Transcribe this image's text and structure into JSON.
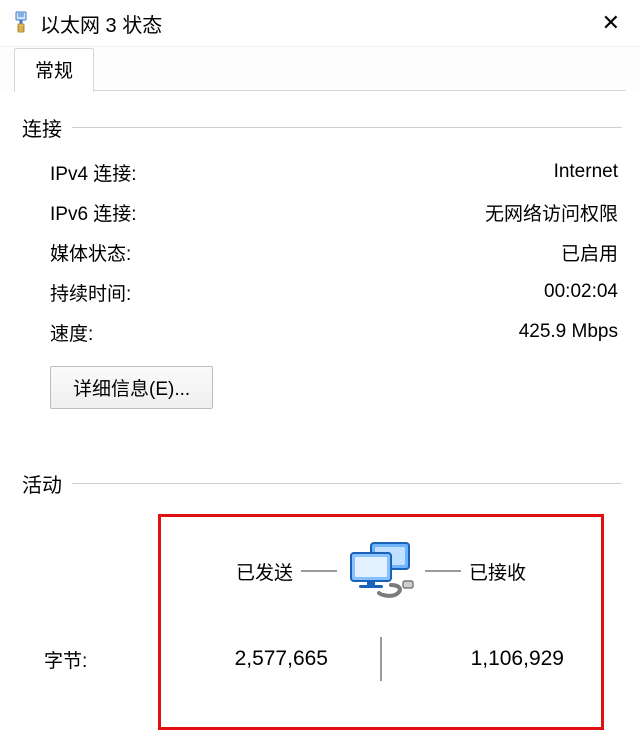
{
  "title": "以太网 3 状态",
  "tabs": {
    "general": "常规"
  },
  "sections": {
    "connection": {
      "label": "连接",
      "rows": {
        "ipv4_label": "IPv4 连接:",
        "ipv4_value": "Internet",
        "ipv6_label": "IPv6 连接:",
        "ipv6_value": "无网络访问权限",
        "media_label": "媒体状态:",
        "media_value": "已启用",
        "duration_label": "持续时间:",
        "duration_value": "00:02:04",
        "speed_label": "速度:",
        "speed_value": "425.9 Mbps"
      },
      "details_btn": "详细信息(E)..."
    },
    "activity": {
      "label": "活动",
      "sent_label": "已发送",
      "recv_label": "已接收",
      "bytes_label": "字节:",
      "sent_value": "2,577,665",
      "recv_value": "1,106,929"
    }
  }
}
